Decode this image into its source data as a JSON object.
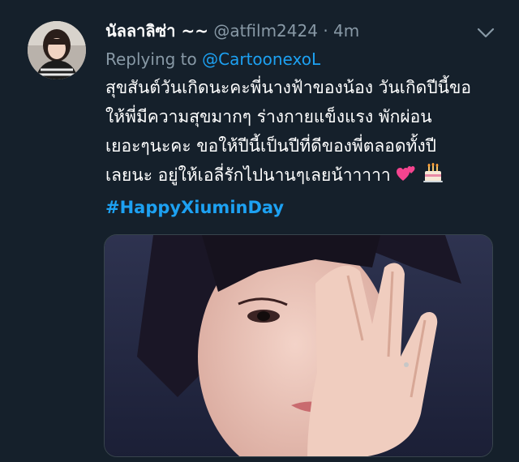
{
  "tweet": {
    "display_name": "นัลลาลิซ่า ~~",
    "handle": "@atfilm2424",
    "separator": "·",
    "time": "4m",
    "reply_prefix": "Replying to",
    "reply_mention": "@CartoonexoL",
    "body_lines": [
      "สุขสันต์วันเกิดนะคะพี่นางฟ้าของน้อง วันเกิดปีนี้ขอ",
      "ให้พี่มีความสุขมากๆ ร่างกายแข็งแรง พักผ่อน",
      "เยอะๆนะคะ ขอให้ปีนี้เป็นปีที่ดีของพี่ตลอดทั้งปี",
      "เลยนะ อยู่ให้เอลี่รักไปนานๆเลยน้าาาาา"
    ],
    "hashtag": "#HappyXiuminDay",
    "emoji_icons": [
      "two-hearts-icon",
      "birthday-cake-icon"
    ],
    "media_description": "photo"
  },
  "colors": {
    "background": "#15202b",
    "text": "#ffffff",
    "muted": "#8899a6",
    "link": "#1da1f2"
  }
}
